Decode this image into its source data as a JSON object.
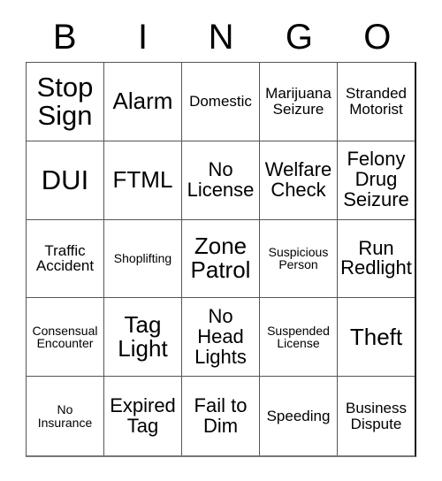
{
  "card": {
    "title": "BINGO",
    "headers": [
      "B",
      "I",
      "N",
      "G",
      "O"
    ],
    "colors": {
      "background": "#ffffff",
      "text": "#000000",
      "grid_line": "#555555",
      "outer_border": "#111111"
    },
    "rows": [
      [
        {
          "label": "Stop Sign",
          "size": "fs-xl"
        },
        {
          "label": "Alarm",
          "size": "fs-lg"
        },
        {
          "label": "Domestic",
          "size": "fs-sm"
        },
        {
          "label": "Marijuana Seizure",
          "size": "fs-sm"
        },
        {
          "label": "Stranded Motorist",
          "size": "fs-sm"
        }
      ],
      [
        {
          "label": "DUI",
          "size": "fs-xl"
        },
        {
          "label": "FTML",
          "size": "fs-lg"
        },
        {
          "label": "No License",
          "size": "fs-md"
        },
        {
          "label": "Welfare Check",
          "size": "fs-md"
        },
        {
          "label": "Felony Drug Seizure",
          "size": "fs-md"
        }
      ],
      [
        {
          "label": "Traffic Accident",
          "size": "fs-sm"
        },
        {
          "label": "Shoplifting",
          "size": "fs-xs"
        },
        {
          "label": "Zone Patrol",
          "size": "fs-lg"
        },
        {
          "label": "Suspicious Person",
          "size": "fs-xs"
        },
        {
          "label": "Run Redlight",
          "size": "fs-md"
        }
      ],
      [
        {
          "label": "Consensual Encounter",
          "size": "fs-xs"
        },
        {
          "label": "Tag Light",
          "size": "fs-lg"
        },
        {
          "label": "No Head Lights",
          "size": "fs-md"
        },
        {
          "label": "Suspended License",
          "size": "fs-xs"
        },
        {
          "label": "Theft",
          "size": "fs-lg"
        }
      ],
      [
        {
          "label": "No Insurance",
          "size": "fs-xs"
        },
        {
          "label": "Expired Tag",
          "size": "fs-md"
        },
        {
          "label": "Fail to Dim",
          "size": "fs-md"
        },
        {
          "label": "Speeding",
          "size": "fs-sm"
        },
        {
          "label": "Business Dispute",
          "size": "fs-sm"
        }
      ]
    ]
  }
}
